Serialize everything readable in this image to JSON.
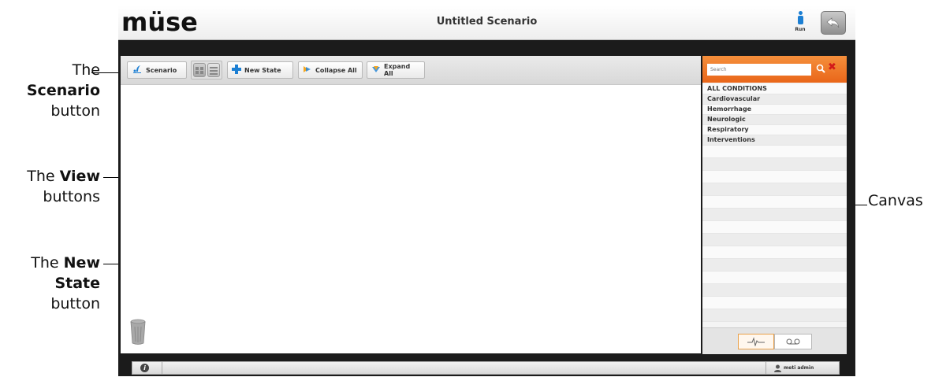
{
  "annotations": {
    "scenario": {
      "pre": "The",
      "bold": "Scenario",
      "post": "button"
    },
    "view": {
      "pre": "The",
      "bold": "View",
      "post": "buttons"
    },
    "new_state": {
      "pre": "The",
      "bold": "New State",
      "bold_line2": "State",
      "bold_line1": "New",
      "post": "button"
    },
    "canvas": "Canvas"
  },
  "app": {
    "logo": "müse",
    "title": "Untitled Scenario",
    "run_label": "Run",
    "toolbar": {
      "scenario_label": "Scenario",
      "new_state_label": "New State",
      "collapse_label": "Collapse All",
      "expand_label": "Expand All"
    },
    "search": {
      "placeholder": "Search"
    },
    "conditions": [
      "ALL CONDITIONS",
      "Cardiovascular",
      "Hemorrhage",
      "Neurologic",
      "Respiratory",
      "Interventions"
    ],
    "status": {
      "user": "meti admin"
    }
  },
  "colors": {
    "accent_orange": "#e9661a",
    "brand_blue": "#1c7fd3",
    "close_red": "#d21a1a"
  }
}
